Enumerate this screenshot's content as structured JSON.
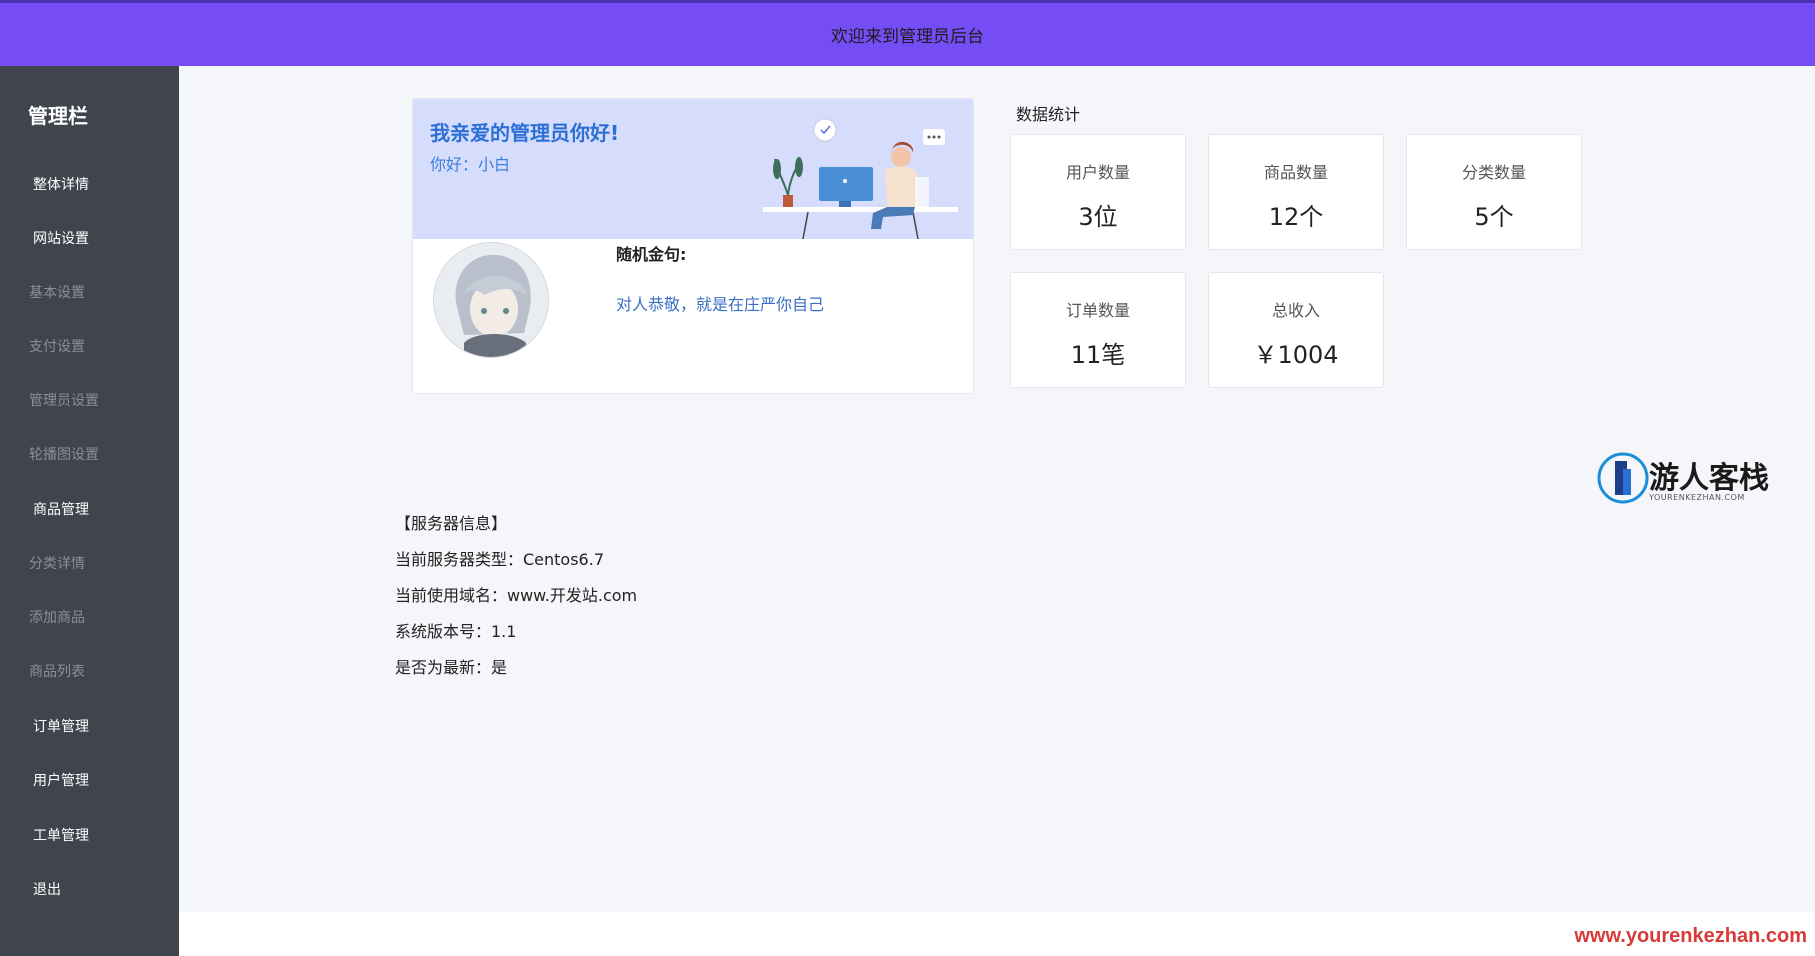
{
  "header": {
    "title": "欢迎来到管理员后台"
  },
  "sidebar": {
    "title": "管理栏",
    "items": [
      {
        "label": "整体详情",
        "type": "primary"
      },
      {
        "label": "网站设置",
        "type": "primary"
      },
      {
        "label": "基本设置",
        "type": "sub"
      },
      {
        "label": "支付设置",
        "type": "sub"
      },
      {
        "label": "管理员设置",
        "type": "sub"
      },
      {
        "label": "轮播图设置",
        "type": "sub"
      },
      {
        "label": "商品管理",
        "type": "primary"
      },
      {
        "label": "分类详情",
        "type": "sub"
      },
      {
        "label": "添加商品",
        "type": "sub"
      },
      {
        "label": "商品列表",
        "type": "sub"
      },
      {
        "label": "订单管理",
        "type": "primary"
      },
      {
        "label": "用户管理",
        "type": "primary"
      },
      {
        "label": "工单管理",
        "type": "primary"
      },
      {
        "label": "退出",
        "type": "primary"
      }
    ]
  },
  "welcome": {
    "heading": "我亲爱的管理员你好!",
    "greeting": "你好：小白",
    "quote_label": "随机金句:",
    "quote_text": "对人恭敬，就是在庄严你自己"
  },
  "stats": {
    "title": "数据统计",
    "cards": [
      {
        "label": "用户数量",
        "value": "3位"
      },
      {
        "label": "商品数量",
        "value": "12个"
      },
      {
        "label": "分类数量",
        "value": "5个"
      },
      {
        "label": "订单数量",
        "value": "11笔"
      },
      {
        "label": "总收入",
        "value": "￥1004"
      }
    ]
  },
  "server": {
    "heading": "【服务器信息】",
    "lines": [
      "当前服务器类型：Centos6.7",
      "当前使用域名：www.开发站.com",
      "系统版本号：1.1",
      "是否为最新：是"
    ]
  },
  "watermark": {
    "brand_name": "游人客栈",
    "brand_sub": "YOURENKEZHAN.COM",
    "footer_url": "www.yourenkezhan.com"
  },
  "colors": {
    "header_bg": "#764cf5",
    "sidebar_bg": "#3f444d",
    "banner_bg": "#d6dcfb",
    "heading_blue": "#2c6fd6",
    "footer_red": "#d83a3a"
  }
}
